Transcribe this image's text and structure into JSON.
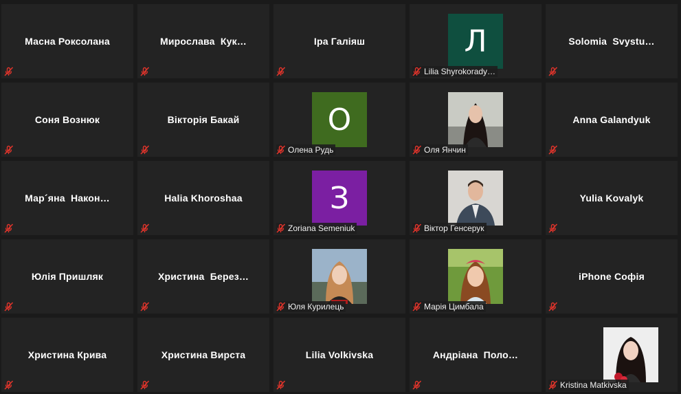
{
  "colors": {
    "background": "#1a1a1a",
    "tile": "#232323",
    "muted_icon": "#e0342b"
  },
  "participants": [
    {
      "name": "Масна Роксолана",
      "mode": "name"
    },
    {
      "name": "Мирослава  Кук…",
      "mode": "name"
    },
    {
      "name": "Іра Галіяш",
      "mode": "name"
    },
    {
      "name": "Lilia Shyrokorady…",
      "mode": "avatar",
      "initial": "Л",
      "color": "#0f4f3f"
    },
    {
      "name": "Solomia  Svystu…",
      "mode": "name"
    },
    {
      "name": "Соня Вознюк",
      "mode": "name"
    },
    {
      "name": "Вікторія Бакай",
      "mode": "name"
    },
    {
      "name": "Олена Рудь",
      "mode": "avatar",
      "initial": "О",
      "color": "#3f6b1f"
    },
    {
      "name": "Оля Янчин",
      "mode": "photo",
      "photo_icon": "woman-dark-hair-photo"
    },
    {
      "name": "Anna Galandyuk",
      "mode": "name"
    },
    {
      "name": "Мар´яна  Након…",
      "mode": "name"
    },
    {
      "name": "Halia Khoroshaa",
      "mode": "name"
    },
    {
      "name": "Zoriana Semeniuk",
      "mode": "avatar",
      "initial": "З",
      "color": "#7b1fa2"
    },
    {
      "name": "Віктор Генсерук",
      "mode": "photo",
      "photo_icon": "man-suit-photo"
    },
    {
      "name": "Yulia Kovalyk",
      "mode": "name"
    },
    {
      "name": "Юлія Пришляк",
      "mode": "name"
    },
    {
      "name": "Христина  Берез…",
      "mode": "name"
    },
    {
      "name": "Юля Курилець",
      "mode": "photo",
      "photo_icon": "woman-light-hair-photo"
    },
    {
      "name": "Марія Цимбала",
      "mode": "photo",
      "photo_icon": "girl-outdoor-photo"
    },
    {
      "name": "iPhone Софія",
      "mode": "name"
    },
    {
      "name": "Христина Крива",
      "mode": "name"
    },
    {
      "name": "Христина Вирста",
      "mode": "name"
    },
    {
      "name": "Lilia Volkivska",
      "mode": "name"
    },
    {
      "name": "Андріана  Поло…",
      "mode": "name"
    },
    {
      "name": "Kristina Matkivska",
      "mode": "photo",
      "photo_icon": "woman-flowers-photo"
    }
  ]
}
